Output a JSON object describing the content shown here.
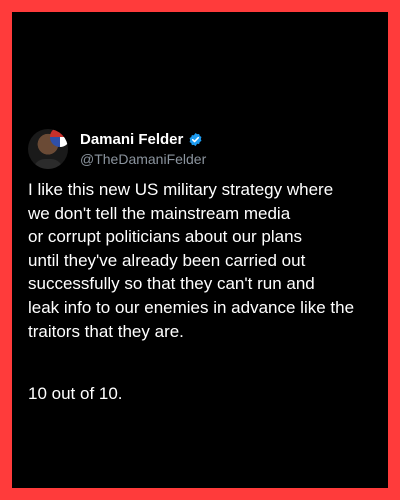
{
  "post": {
    "author": {
      "display_name": "Damani Felder",
      "handle": "@TheDamaniFelder",
      "verified_icon": "verified-badge-icon",
      "avatar_icon": "avatar"
    },
    "text": "I like this new US military strategy where\nwe don't tell the mainstream media\nor corrupt politicians about our plans\nuntil they've already been carried out\nsuccessfully so that they can't run and\nleak info to our enemies in advance like the\ntraitors that they are.",
    "rating": "10 out of 10."
  },
  "colors": {
    "frame": "#ff3b3b",
    "background": "#000000",
    "text": "#ffffff",
    "secondary_text": "#8b949e",
    "verified": "#1d9bf0"
  }
}
